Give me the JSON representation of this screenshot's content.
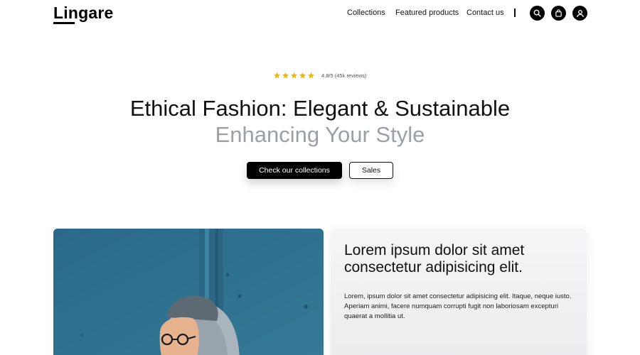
{
  "brand": {
    "name": "Lingare"
  },
  "nav": {
    "collections": "Collections",
    "featured": "Featured products",
    "contact": "Contact us"
  },
  "icons": [
    "search-icon",
    "shopping-bag-icon",
    "user-icon",
    "star-icon"
  ],
  "colors": {
    "accent": "#000000",
    "star": "#f5b800",
    "subtitle": "#9ba0a8",
    "photo_bg": "#2f6f8c"
  },
  "hero": {
    "rating_stars": 5,
    "rating_text": "4.8/5 (45k reviews)",
    "title": "Ethical Fashion: Elegant & Sustainable",
    "subtitle": "Enhancing Your Style",
    "primary_button": "Check our collections",
    "secondary_button": "Sales"
  },
  "feature": {
    "title": "Lorem ipsum dolor sit amet consectetur adipisicing elit.",
    "body": "Lorem, ipsum dolor sit amet consectetur adipisicing elit. Itaque, neque iusto. Aperiam animi, facere numquam corrupti fugit non laboriosam excepturi quaerat a mollitia ut."
  }
}
